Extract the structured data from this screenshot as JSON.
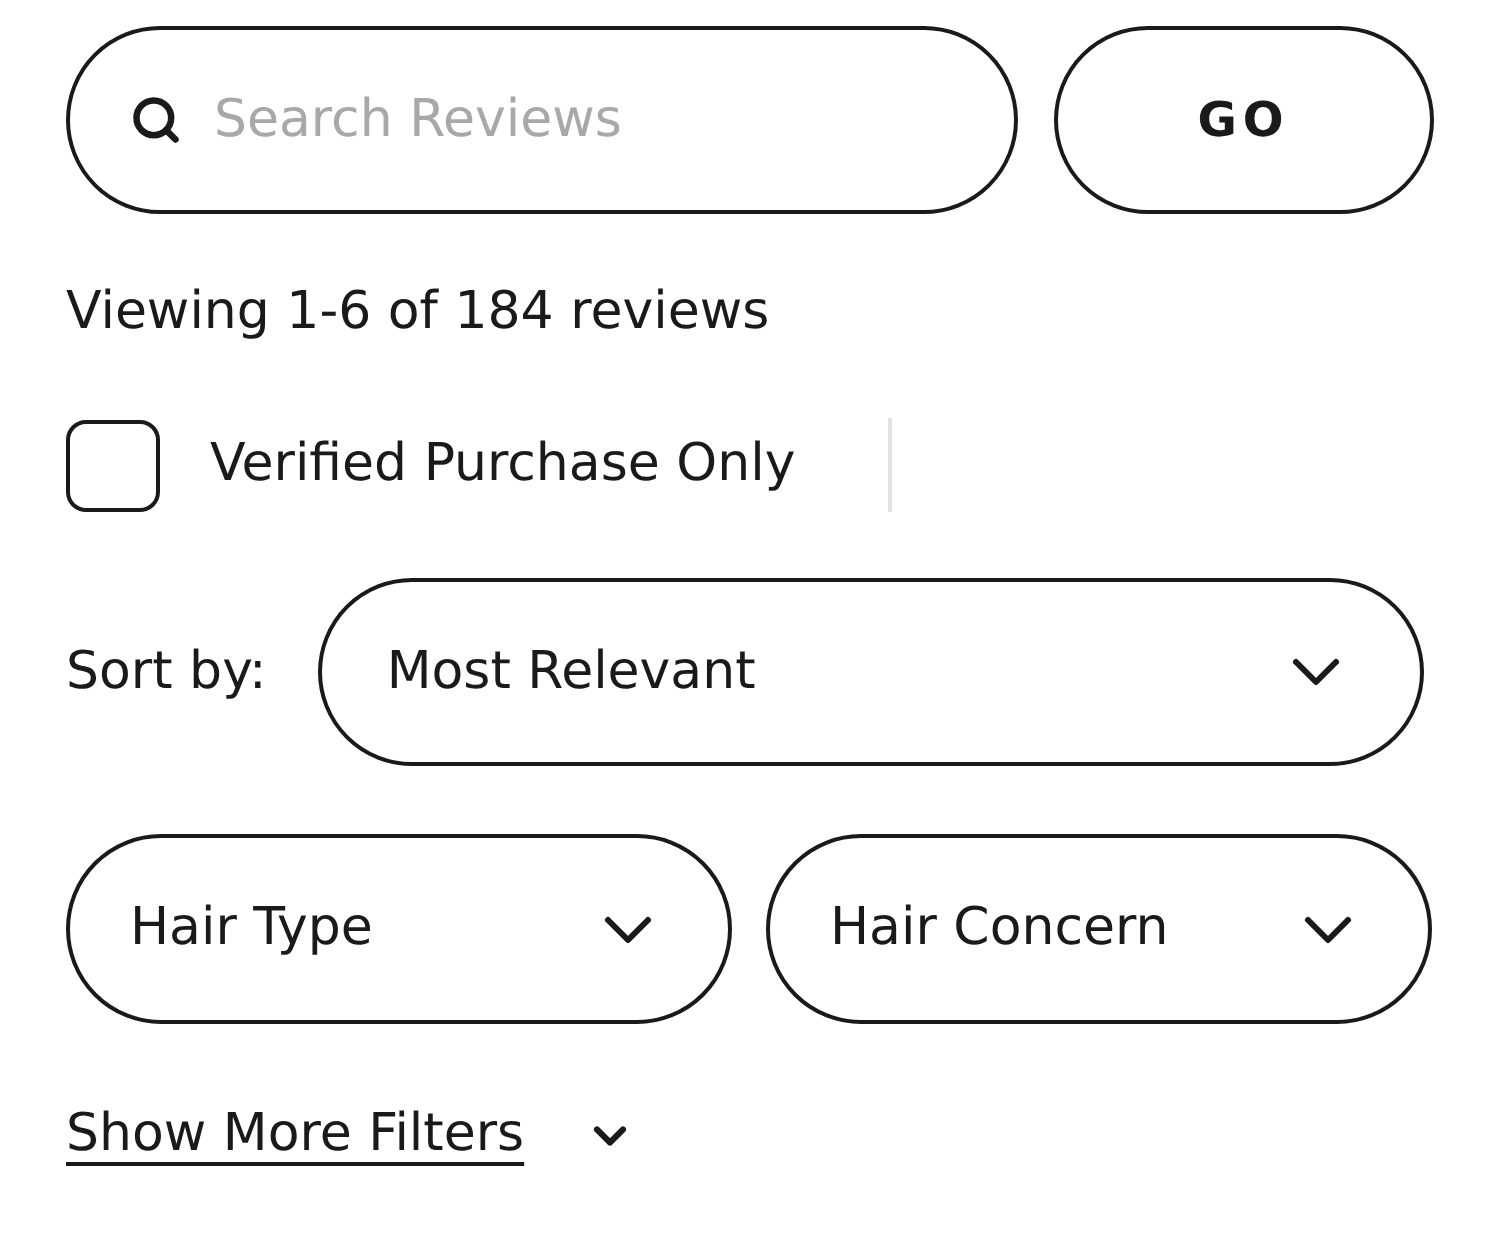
{
  "search": {
    "placeholder": "Search Reviews",
    "button": "GO"
  },
  "summary": "Viewing 1-6 of 184 reviews",
  "verified_filter": {
    "label": "Verified Purchase Only",
    "checked": false
  },
  "sort": {
    "label": "Sort by:",
    "value": "Most Relevant"
  },
  "filters": [
    {
      "label": "Hair Type"
    },
    {
      "label": "Hair Concern"
    }
  ],
  "more_filters": {
    "label": "Show More Filters",
    "expanded": false
  }
}
